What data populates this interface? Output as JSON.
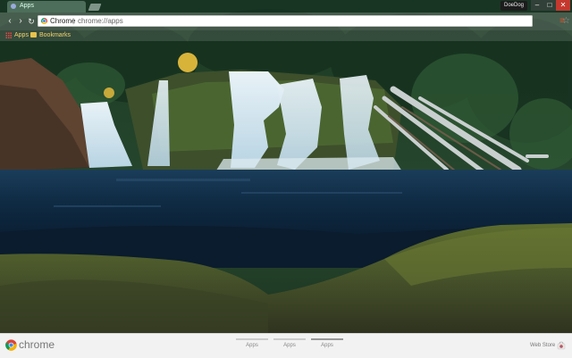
{
  "window": {
    "tab_label": "Apps",
    "profile_name": "DoeDog",
    "controls": [
      "–",
      "□",
      "✕"
    ]
  },
  "toolbar": {
    "omnibox_chrome_label": "Chrome",
    "omnibox_separator": "|",
    "omnibox_url": "chrome://apps"
  },
  "bookmarks_bar": {
    "items": [
      {
        "label": "Apps",
        "icon": "apps-grid-icon"
      },
      {
        "label": "Bookmarks",
        "icon": "folder-icon"
      }
    ]
  },
  "bottom_bar": {
    "brand": "chrome",
    "page_tabs": [
      {
        "label": "Apps",
        "active": false
      },
      {
        "label": "Apps",
        "active": false
      },
      {
        "label": "Apps",
        "active": true
      }
    ],
    "webstore_label": "Web Store"
  },
  "colors": {
    "close_button": "#c4382e",
    "menu_accent": "#d8552b",
    "bookmark_text": "#f5d36b"
  }
}
